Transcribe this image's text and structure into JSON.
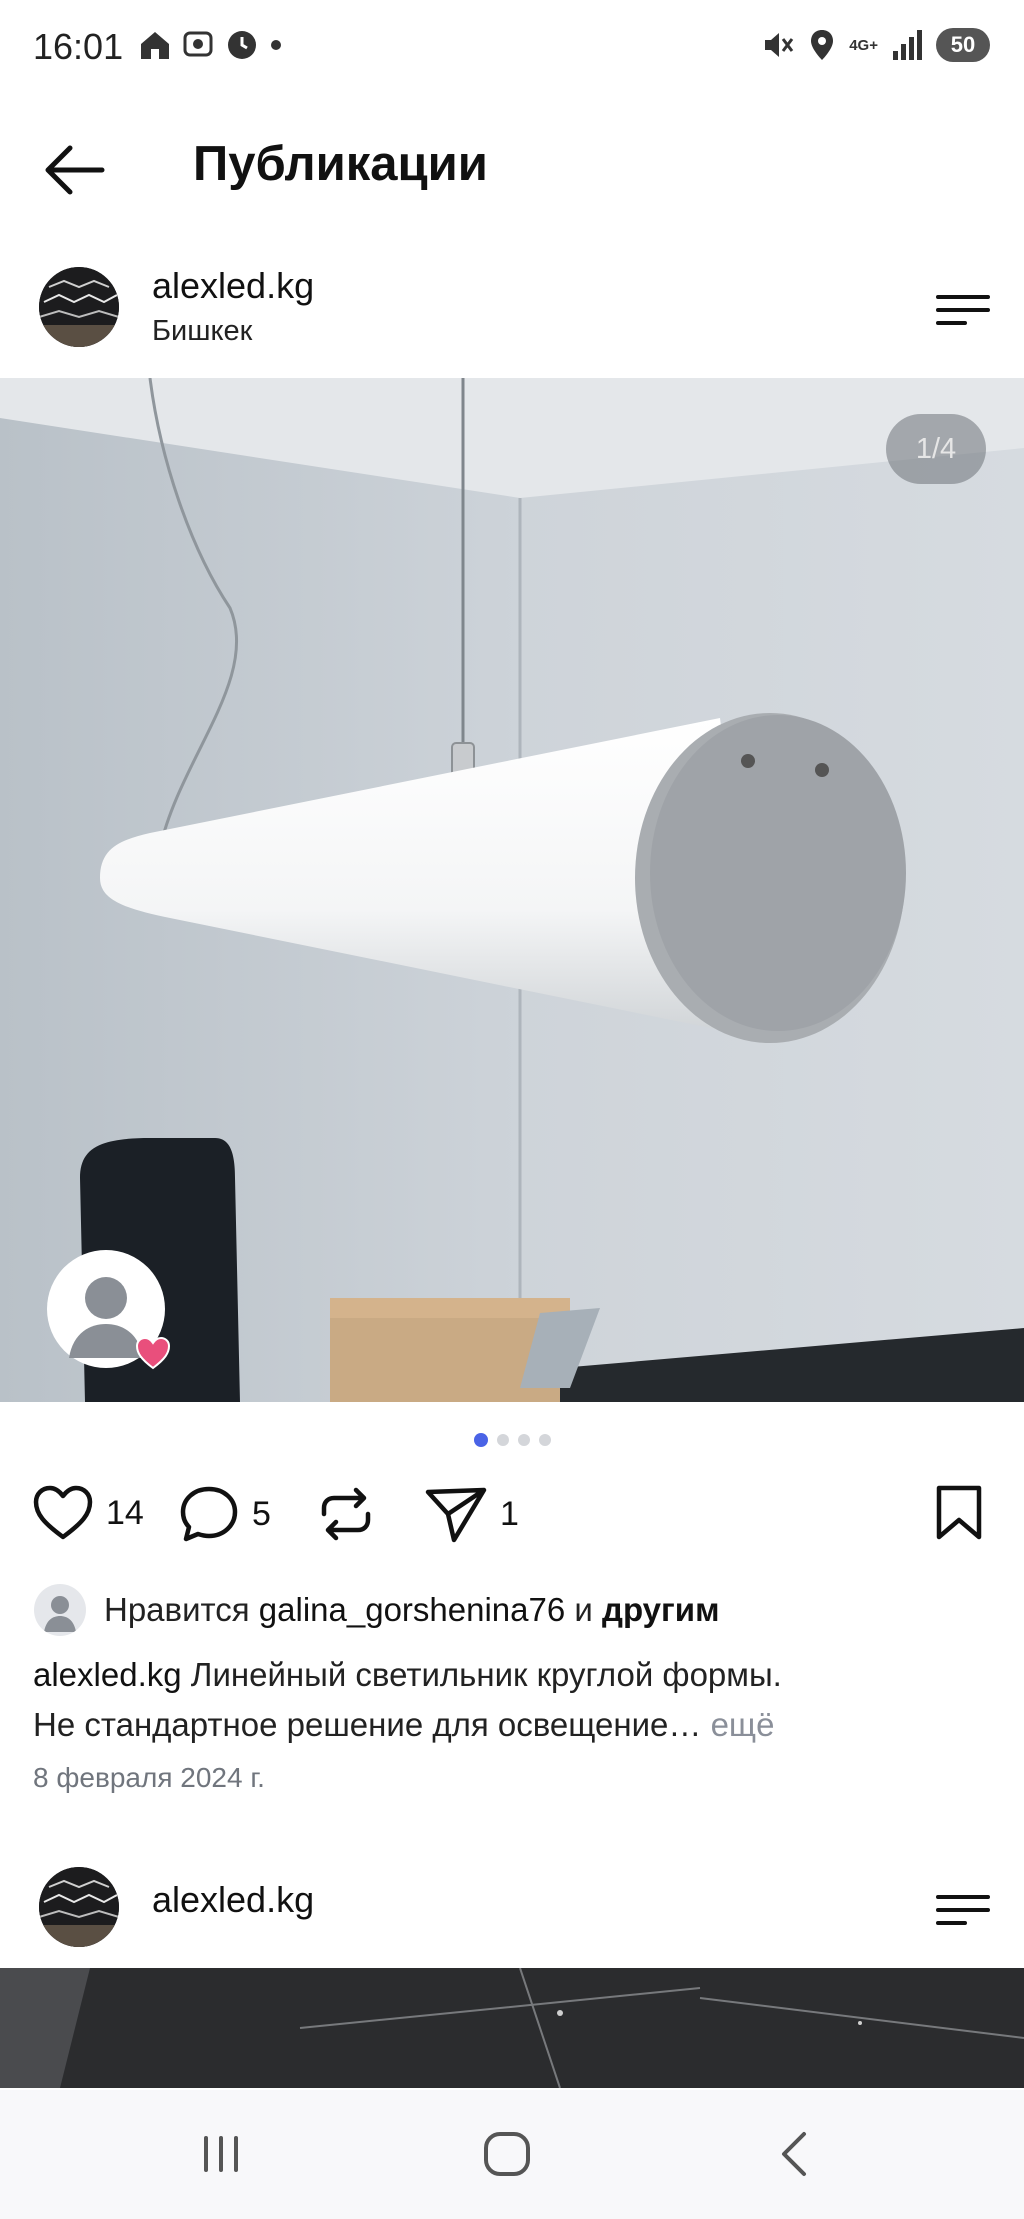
{
  "status_bar": {
    "time": "16:01",
    "network": "4G+",
    "battery": "50",
    "icons": [
      "home-icon",
      "chat-icon",
      "clock-icon",
      "dot-icon",
      "mute-icon",
      "location-icon",
      "signal-icon",
      "battery-icon"
    ]
  },
  "header": {
    "title": "Публикации",
    "back_icon": "arrow-left-icon"
  },
  "post": {
    "username": "alexled.kg",
    "location": "Бишкек",
    "menu_icon": "menu-icon",
    "media_counter": "1/4",
    "carousel": {
      "count": 4,
      "active": 0
    },
    "actions": {
      "likes": "14",
      "comments": "5",
      "shares": "1",
      "icons": [
        "heart-icon",
        "comment-icon",
        "repost-icon",
        "send-icon",
        "bookmark-icon"
      ]
    },
    "liked_by": {
      "prefix": "Нравится",
      "user": "galina_gorshenina76",
      "conj": "и",
      "others": "другим"
    },
    "caption": {
      "username": "alexled.kg",
      "line1": "Линейный светильник круглой формы.",
      "line2": "Не стандартное решение для освещение…",
      "more": "ещё"
    },
    "date": "8 февраля 2024 г."
  },
  "next_post": {
    "username": "alexled.kg",
    "menu_icon": "menu-icon"
  },
  "nav_bar": {
    "icons": [
      "recents-icon",
      "home-icon",
      "back-icon"
    ]
  },
  "colors": {
    "accent": "#4a63e6",
    "text": "#111111",
    "muted": "#70757d"
  }
}
